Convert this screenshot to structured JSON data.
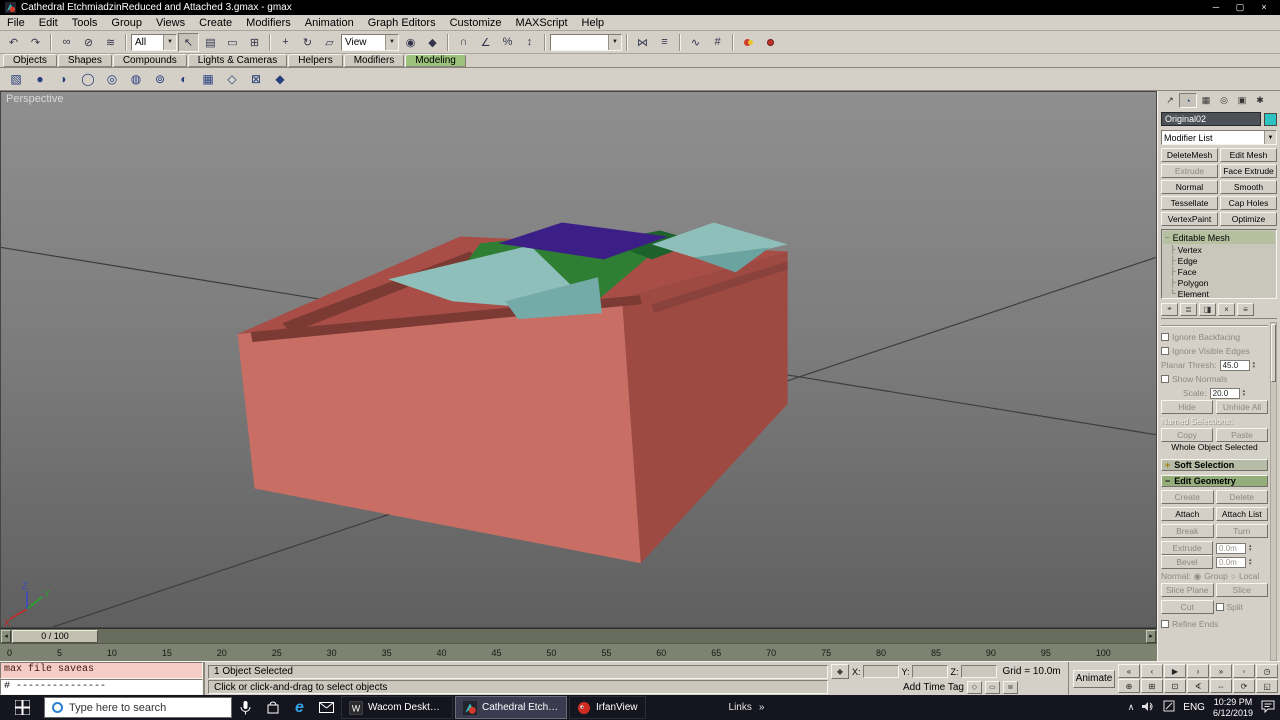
{
  "window": {
    "title": "Cathedral EtchmiadzinReduced and Attached 3.gmax - gmax"
  },
  "menu": {
    "items": [
      "File",
      "Edit",
      "Tools",
      "Group",
      "Views",
      "Create",
      "Modifiers",
      "Animation",
      "Graph Editors",
      "Customize",
      "MAXScript",
      "Help"
    ]
  },
  "toolbar": {
    "filter_value": "All",
    "coord_value": "View"
  },
  "tabs": {
    "items": [
      "Objects",
      "Shapes",
      "Compounds",
      "Lights & Cameras",
      "Helpers",
      "Modifiers",
      "Modeling"
    ]
  },
  "viewport": {
    "label": "Perspective",
    "axis_x": "X",
    "axis_y": "Y",
    "axis_z": "Z"
  },
  "timeline": {
    "slider_label": "0 / 100",
    "ticks": [
      "0",
      "5",
      "10",
      "15",
      "20",
      "25",
      "30",
      "35",
      "40",
      "45",
      "50",
      "55",
      "60",
      "65",
      "70",
      "75",
      "80",
      "85",
      "90",
      "95",
      "100"
    ]
  },
  "command_panel": {
    "object_name": "Original02",
    "modifier_list_label": "Modifier List",
    "buttons": [
      "DeleteMesh",
      "Edit Mesh",
      "Extrude",
      "Face Extrude",
      "Normal",
      "Smooth",
      "Tessellate",
      "Cap Holes",
      "VertexPaint",
      "Optimize"
    ],
    "stack_root": "Editable Mesh",
    "stack_children": [
      "Vertex",
      "Edge",
      "Face",
      "Polygon",
      "Element"
    ],
    "surface": {
      "ignore_backfacing": "Ignore Backfacing",
      "ignore_visible_edges": "Ignore Visible Edges",
      "planar_thresh_label": "Planar Thresh:",
      "planar_thresh_value": "45.0",
      "show_normals": "Show Normals",
      "scale_label": "Scale:",
      "scale_value": "20.0",
      "hide": "Hide",
      "unhide": "Unhide All",
      "named_selections": "Named Selections:",
      "copy": "Copy",
      "paste": "Paste",
      "whole_object": "Whole Object Selected"
    },
    "rollout_soft": "Soft Selection",
    "rollout_edit": "Edit Geometry",
    "edit_geometry": {
      "create": "Create",
      "delete": "Delete",
      "attach": "Attach",
      "attach_list": "Attach List",
      "break_label": "Break",
      "turn": "Turn",
      "extrude": "Extrude",
      "extrude_value": "0.0m",
      "bevel": "Bevel",
      "bevel_value": "0.0m",
      "normal_label": "Normal:",
      "group": "Group",
      "local": "Local",
      "slice_plane": "Slice Plane",
      "slice": "Slice",
      "cut": "Cut",
      "split": "Split",
      "refine_ends": "Refine Ends"
    }
  },
  "status": {
    "macro_line": "max file saveas",
    "listener_line": "# ---------------",
    "selection": "1 Object Selected",
    "prompt": "Click or click-and-drag to select objects",
    "x_label": "X:",
    "y_label": "Y:",
    "z_label": "Z:",
    "grid": "Grid = 10.0m",
    "add_time_tag": "Add Time Tag",
    "animate": "Animate"
  },
  "taskbar": {
    "search_placeholder": "Type here to search",
    "app1": "Wacom Desktop C...",
    "app2": "Cathedral Etchmia...",
    "app3": "IrfanView",
    "links": "Links",
    "lang": "ENG",
    "time": "10:29 PM",
    "date": "6/12/2019"
  },
  "icons": {
    "minimize": "─",
    "restore": "▢",
    "close": "×",
    "undo": "↶",
    "redo": "↷",
    "link": "∞",
    "unlink": "⊘",
    "bind": "≋",
    "select": "↖",
    "by_name": "▤",
    "rect": "▭",
    "wincross": "⊞",
    "move": "+",
    "rotate": "↻",
    "scale": "▱",
    "center": "◉",
    "manip": "◆",
    "snap": "∩",
    "asnap": "∠",
    "psnap": "%",
    "sspin": "↕",
    "mirror": "⋈",
    "align": "≡",
    "curve": "∿",
    "schem": "#",
    "dd": "▼",
    "prims": [
      "▧",
      "●",
      "◗",
      "◯",
      "◎",
      "◍",
      "⊚",
      "◐",
      "▦",
      "◇",
      "⊠",
      "◆"
    ],
    "tab_create": "↗",
    "tab_modify": "◔",
    "tab_hier": "▦",
    "tab_motion": "◎",
    "tab_display": "▣",
    "tab_util": "✱",
    "pin": "⌖",
    "endresult": "≣",
    "unique": "◨",
    "remove": "×",
    "config": "≡",
    "tree_mid": "├",
    "tree_end": "└",
    "plus": "+",
    "minus": "−",
    "radio_on": "◉",
    "radio_off": "○",
    "spin_up": "▴",
    "spin_dn": "▾",
    "ts_left": "◂",
    "ts_right": "▸",
    "lock": "◆",
    "tag1": "◇",
    "tag2": "▭",
    "tag3": "≣",
    "go_start": "«",
    "prev": "‹",
    "play": "▶",
    "next": "›",
    "go_end": "»",
    "key": "◦",
    "time_cfg": "◷",
    "zoom": "⊕",
    "zoom_all": "⊞",
    "extents": "⊡",
    "fov": "∢",
    "pan": "⇔",
    "arc": "⟳",
    "minmax": "◱",
    "chev_up": "∧",
    "links_chev": "»",
    "edge": "e"
  },
  "colors": {
    "model_front": "#c86e64",
    "model_top": "#a84e47",
    "model_right": "#9e4a43",
    "model_terrace_dark": "#7c3a35",
    "patch_green": "#2e7e33",
    "patch_green_dark": "#1c622a",
    "patch_teal": "#8fbfba",
    "patch_purple": "#3b1f86",
    "object_color_swatch": "#2ec3c3",
    "active_tab_green": "#9cc27c",
    "taskbar_bg": "#15151f"
  }
}
